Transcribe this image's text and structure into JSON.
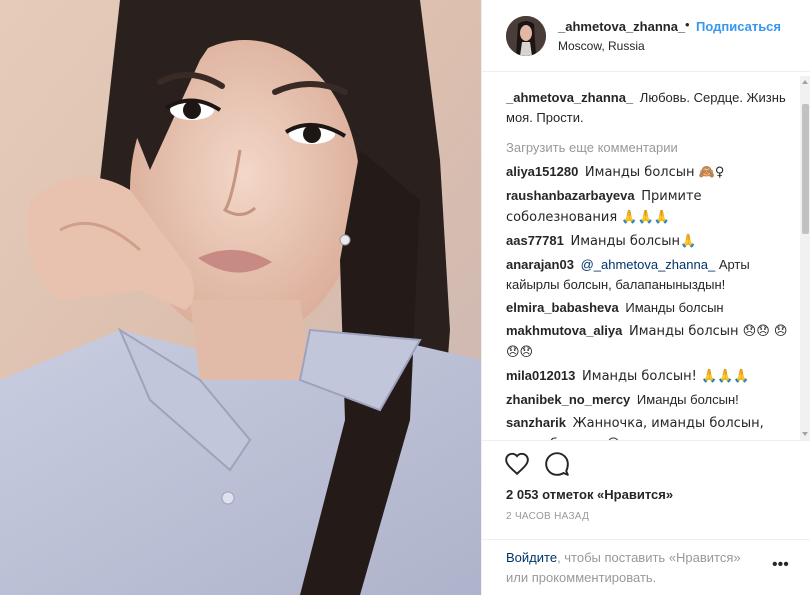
{
  "post": {
    "username": "_ahmetova_zhanna_",
    "dot": "•",
    "follow_label": "Подписаться",
    "location": "Moscow, Russia"
  },
  "caption": {
    "username": "_ahmetova_zhanna_",
    "text": "Любовь. Сердце. Жизнь моя. Прости."
  },
  "load_more_label": "Загрузить еще комментарии",
  "comments": [
    {
      "user": "aliya151280",
      "text": "Иманды болсын 🙈♀"
    },
    {
      "user": "raushanbazarbayeva",
      "text": "Примите соболезнования 🙏🙏🙏"
    },
    {
      "user": "aas77781",
      "text": "Иманды болсын🙏"
    },
    {
      "user": "anarajan03",
      "mention": "@_ahmetova_zhanna_",
      "text": " Арты кайырлы болсын, балапаныныздын!"
    },
    {
      "user": "elmira_babasheva",
      "text": "Иманды болсын"
    },
    {
      "user": "makhmutova_aliya",
      "text": "Иманды болсын 😞😞 😞😞😞"
    },
    {
      "user": "mila012013",
      "text": "Иманды болсын! 🙏🙏🙏"
    },
    {
      "user": "zhanibek_no_mercy",
      "text": "Иманды болсын!"
    },
    {
      "user": "sanzharik",
      "text": "Жанночка, иманды болсын, очень больно. 😔"
    }
  ],
  "likes_text": "2 053 отметок «Нравится»",
  "timestamp": "2 часов назад",
  "login_prompt": {
    "link": "Войдите",
    "rest": ", чтобы поставить «Нравится» или прокомментировать."
  },
  "more_label": "•••",
  "icons": {
    "like": "heart-icon",
    "comment": "comment-bubble-icon",
    "more": "more-options-icon"
  },
  "colors": {
    "accent": "#3897f0",
    "link": "#003569",
    "muted": "#999999",
    "text": "#262626"
  }
}
